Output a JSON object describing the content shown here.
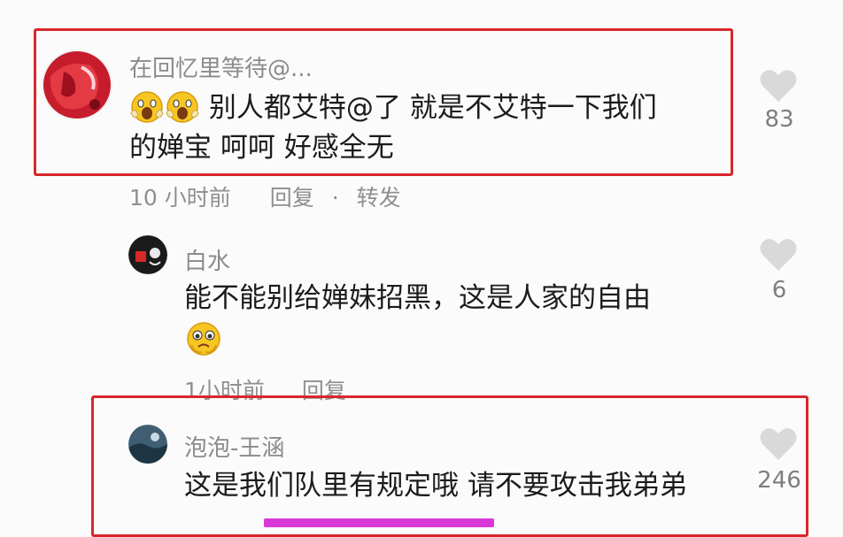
{
  "colors": {
    "highlight": "#d8262b",
    "accent_underline": "#d938d9",
    "meta_gray": "#8f8f8f"
  },
  "comments": [
    {
      "username": "在回忆里等待@...",
      "text_line1": "别人都艾特@了 就是不艾特一下我们",
      "text_line2": "的婵宝 呵呵 好感全无",
      "emoji": "screaming-face-icon",
      "time": "10 小时前",
      "reply": "回复",
      "dot": "·",
      "share": "转发",
      "likes": "83"
    },
    {
      "username": "白水",
      "text": "能不能别给婵妹招黑，这是人家的自由",
      "emoji": "pleading-face-icon",
      "time": "1小时前",
      "reply": "回复",
      "likes": "6"
    },
    {
      "username": "泡泡-王涵",
      "text": "这是我们队里有规定哦 请不要攻击我弟弟",
      "likes": "246"
    }
  ]
}
